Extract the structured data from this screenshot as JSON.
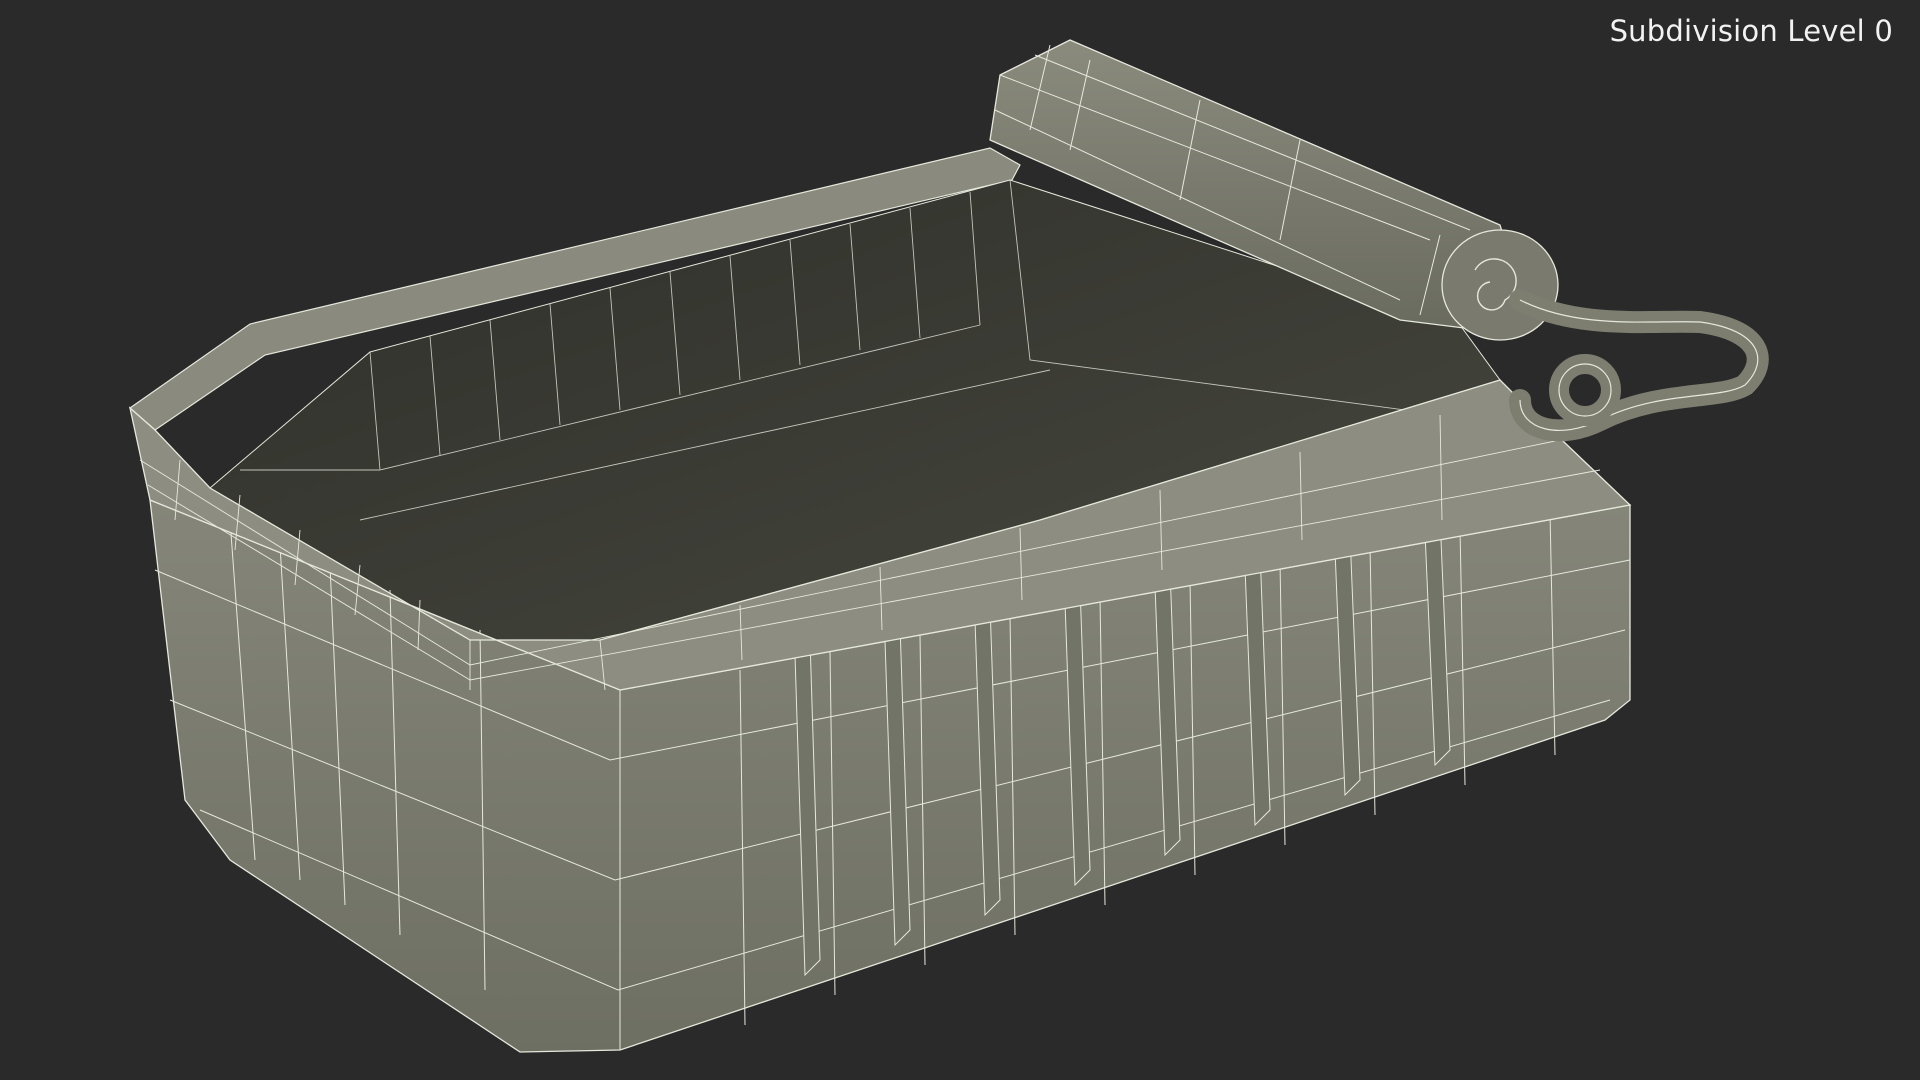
{
  "viewport": {
    "overlay_label": "Subdivision Level 0",
    "model": "sardine-tin-open-lid-wireframe",
    "colors": {
      "background": "#2a2a2a",
      "mesh_fill": "#7d7e70",
      "mesh_fill_dark": "#5d5e52",
      "interior": "#3a3b34",
      "wire": "#e6e8dc"
    }
  }
}
